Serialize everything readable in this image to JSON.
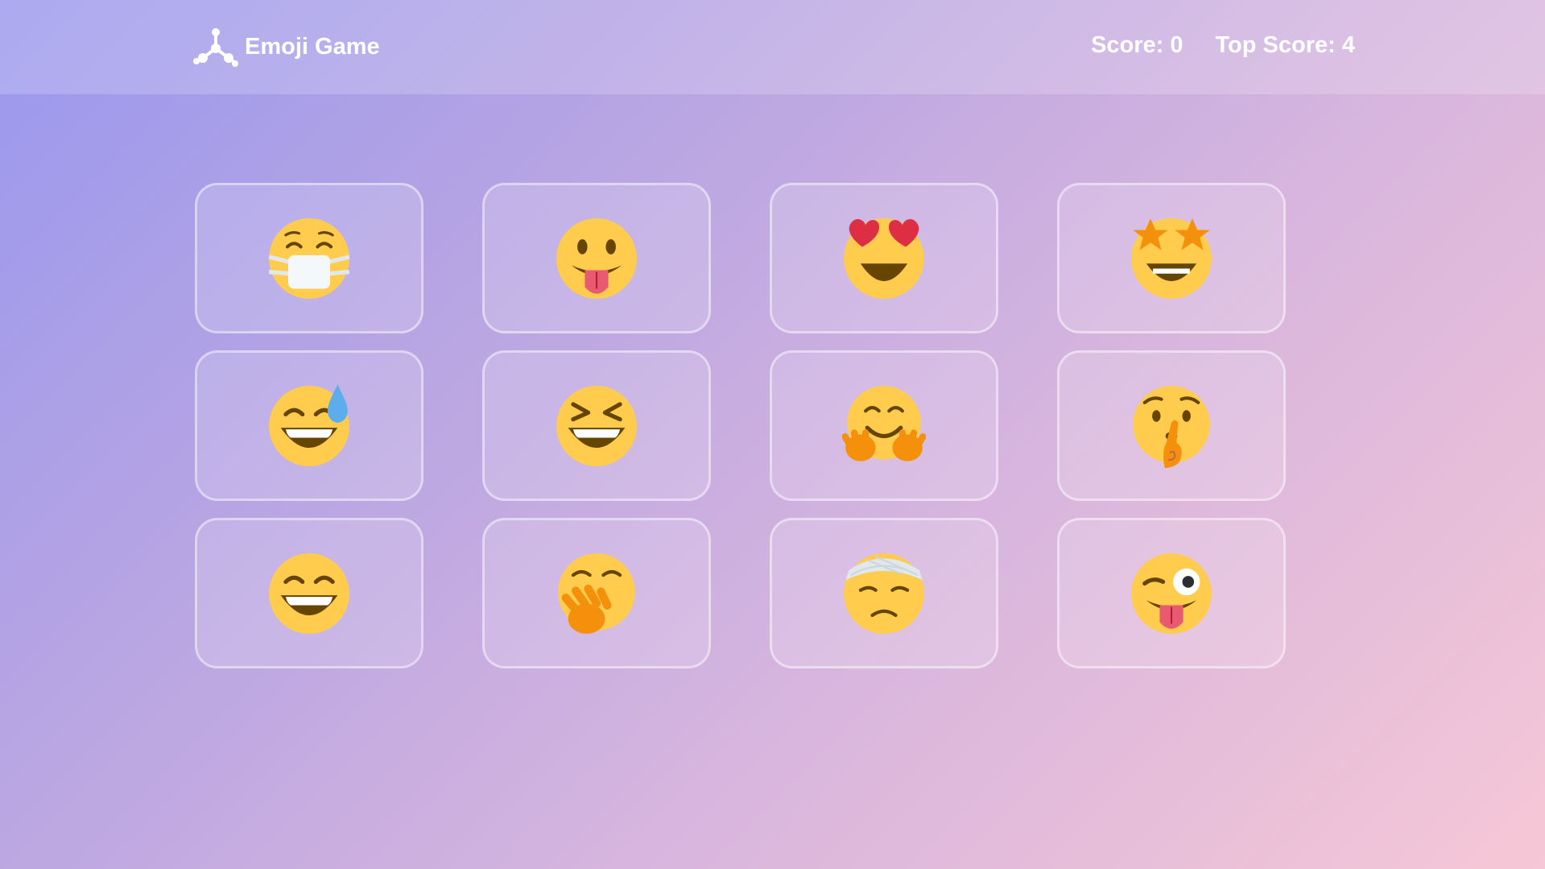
{
  "header": {
    "title": "Emoji Game",
    "logo_icon": "molecule-logo-icon",
    "score_text": "Score: 0",
    "top_score_text": "Top Score: 4"
  },
  "colors": {
    "gradient_start": "#9a98ee",
    "gradient_end": "#f6c7d6",
    "emoji_yellow": "#ffcc4d",
    "emoji_brown": "#664500"
  },
  "emojis": [
    {
      "name": "face-with-medical-mask"
    },
    {
      "name": "face-with-tongue"
    },
    {
      "name": "smiling-face-with-heart-eyes"
    },
    {
      "name": "star-struck"
    },
    {
      "name": "grinning-face-with-sweat"
    },
    {
      "name": "grinning-squinting-face"
    },
    {
      "name": "hugging-face"
    },
    {
      "name": "shushing-face"
    },
    {
      "name": "grinning-face-with-smiling-eyes"
    },
    {
      "name": "face-with-hand-over-mouth"
    },
    {
      "name": "face-with-head-bandage"
    },
    {
      "name": "winking-face-with-tongue"
    }
  ]
}
